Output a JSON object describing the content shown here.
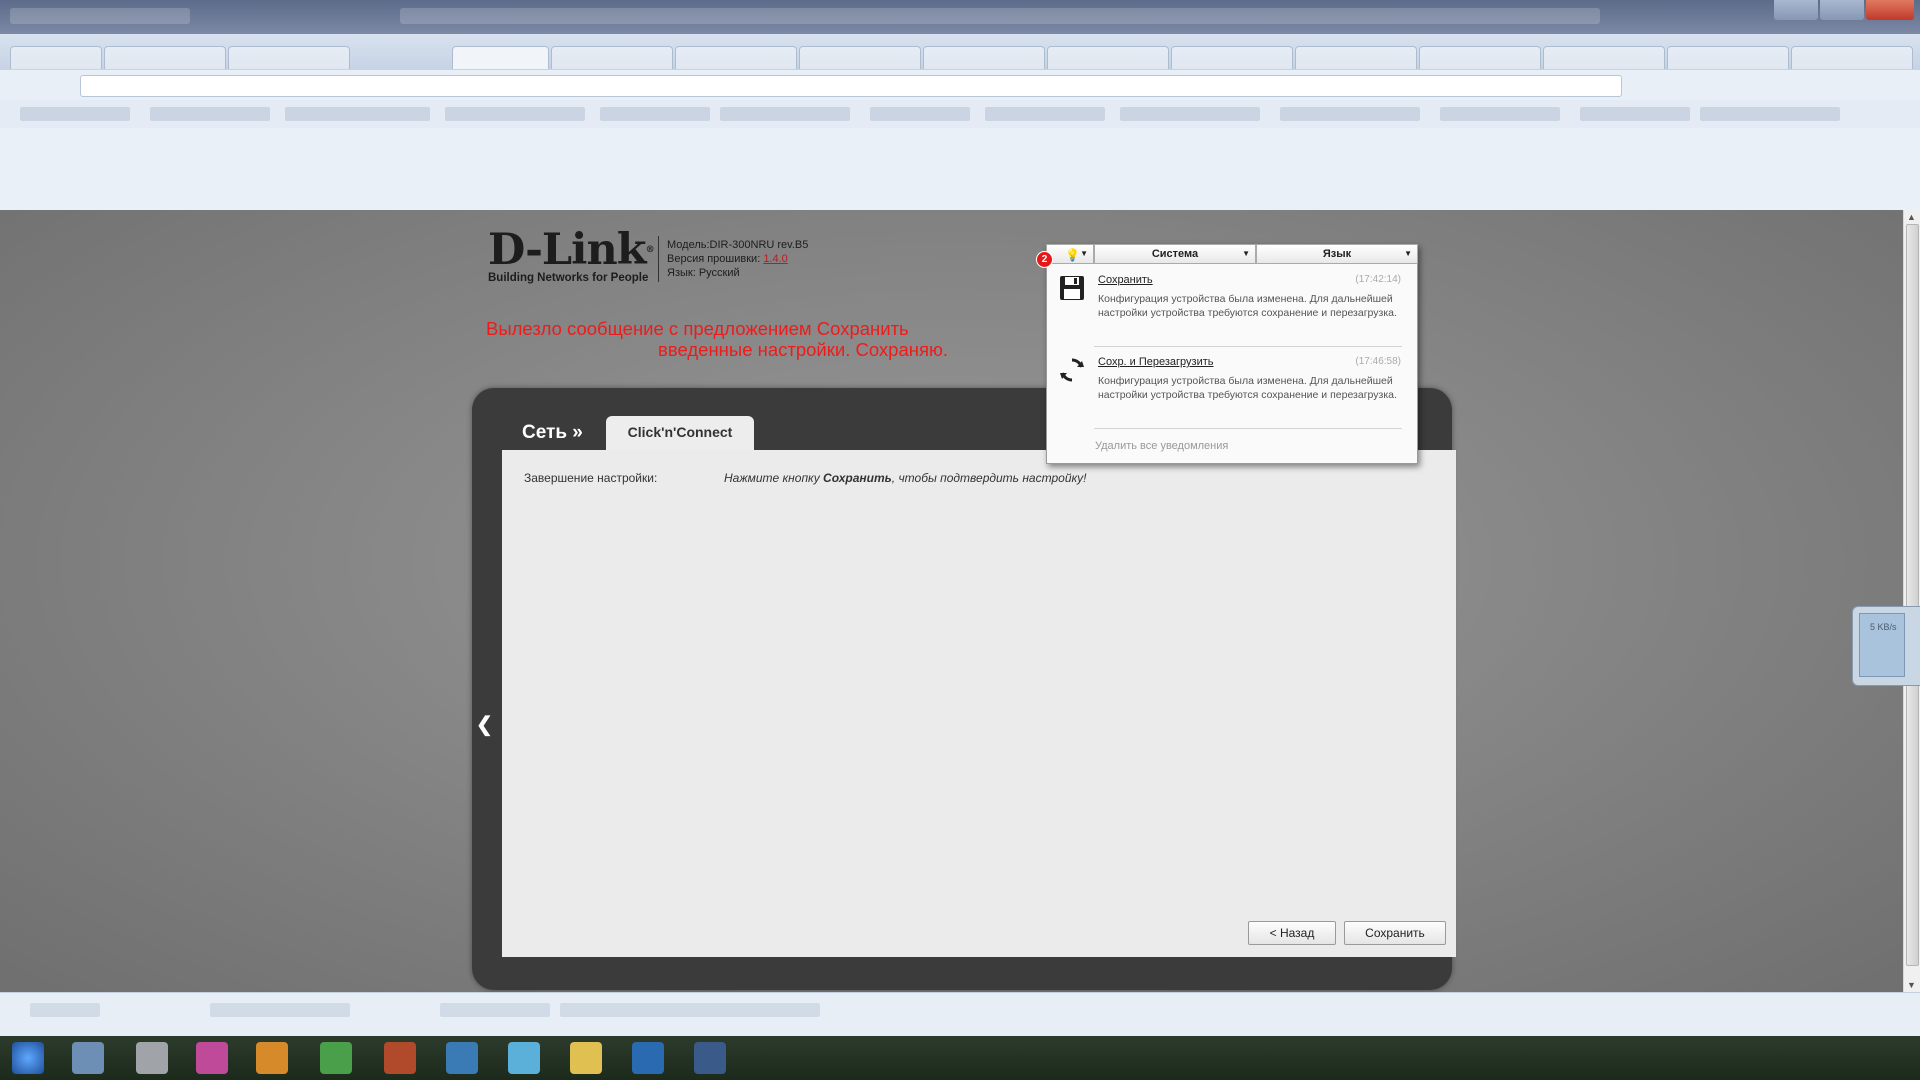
{
  "router": {
    "brand": "D-Link",
    "reg": "®",
    "tagline": "Building Networks for People",
    "model_line": "Модель:DIR-300NRU rev.B5",
    "firmware_label": "Версия прошивки: ",
    "firmware_version": "1.4.0",
    "language_line": "Язык: Русский"
  },
  "annotation": {
    "line1": "Вылезло сообщение с предложением Сохранить",
    "line2": "введенные настройки. Сохраняю."
  },
  "section_title": "Сеть »",
  "active_tab": "Click'n'Connect",
  "form": {
    "label": "Завершение настройки:",
    "hint_prefix": "Нажмите кнопку ",
    "hint_bold": "Сохранить",
    "hint_suffix": ", чтобы подтвердить настройку!"
  },
  "buttons": {
    "back": "< Назад",
    "save": "Сохранить"
  },
  "menu": {
    "system": "Система",
    "language": "Язык",
    "badge_count": "2"
  },
  "notifications": [
    {
      "icon": "floppy-disk-icon",
      "title": "Сохранить",
      "time": "(17:42:14)",
      "text": "Конфигурация устройства была изменена. Для дальнейшей настройки устройства требуются сохранение и перезагрузка."
    },
    {
      "icon": "reload-icon",
      "title": "Сохр. и Перезагрузить",
      "time": "(17:46:58)",
      "text": "Конфигурация устройства была изменена. Для дальнейшей настройки устройства требуются сохранение и перезагрузка."
    }
  ],
  "delete_all": "Удалить все уведомления",
  "widget": {
    "speed": "5 KB/s"
  },
  "colors": {
    "annotation": "#ee1b1b",
    "badge": "#e81818",
    "frame": "#3b3b3b",
    "firmware_link": "#c0191c"
  }
}
